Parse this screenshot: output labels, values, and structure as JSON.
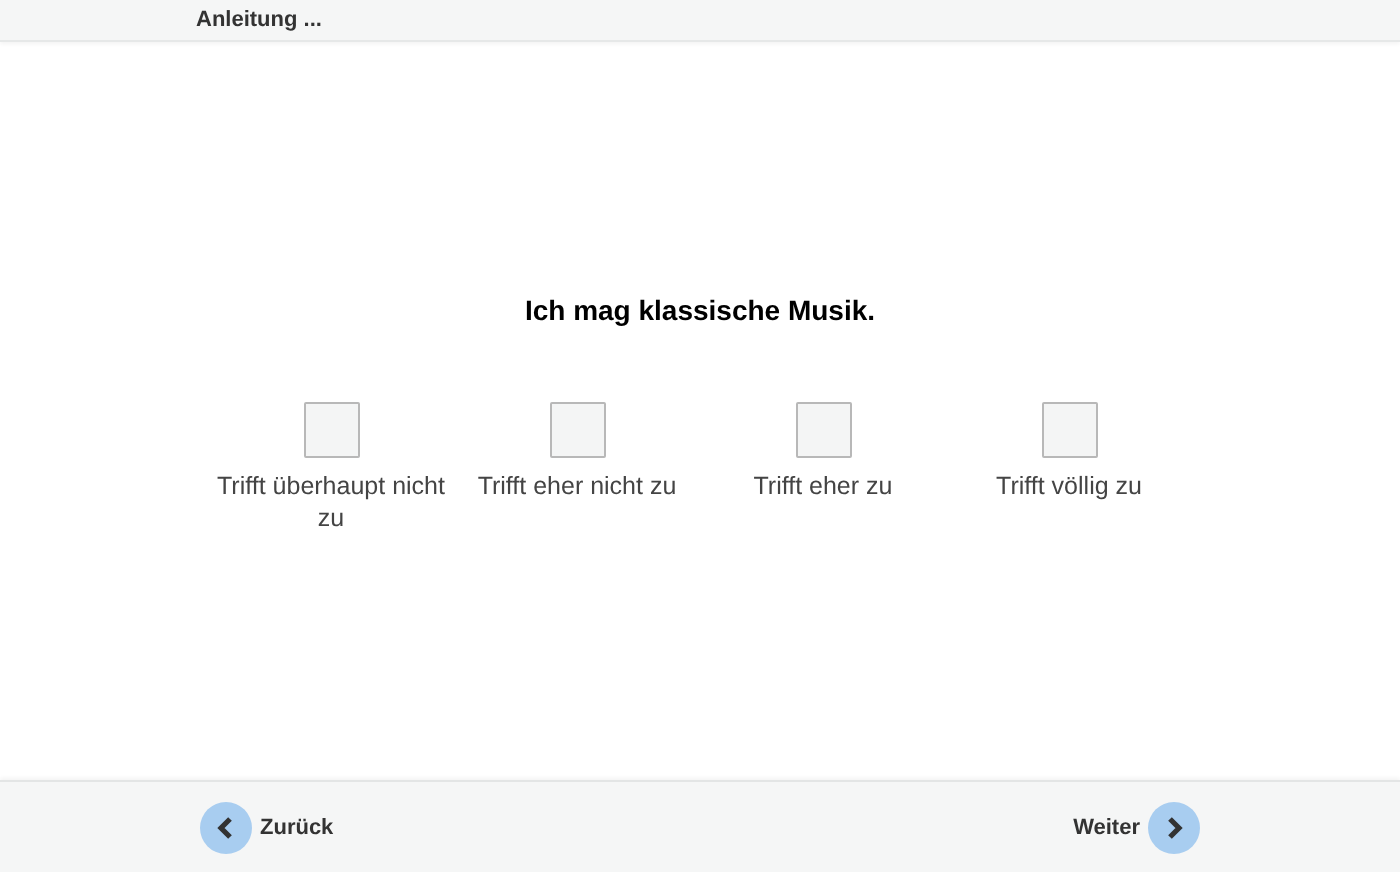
{
  "header": {
    "title": "Anleitung ..."
  },
  "question": "Ich mag klassische Musik.",
  "options": [
    {
      "label": "Trifft überhaupt nicht zu",
      "checked": false
    },
    {
      "label": "Trifft eher nicht zu",
      "checked": false
    },
    {
      "label": "Trifft eher zu",
      "checked": false
    },
    {
      "label": "Trifft völlig zu",
      "checked": false
    }
  ],
  "nav": {
    "back": "Zurück",
    "next": "Weiter"
  }
}
